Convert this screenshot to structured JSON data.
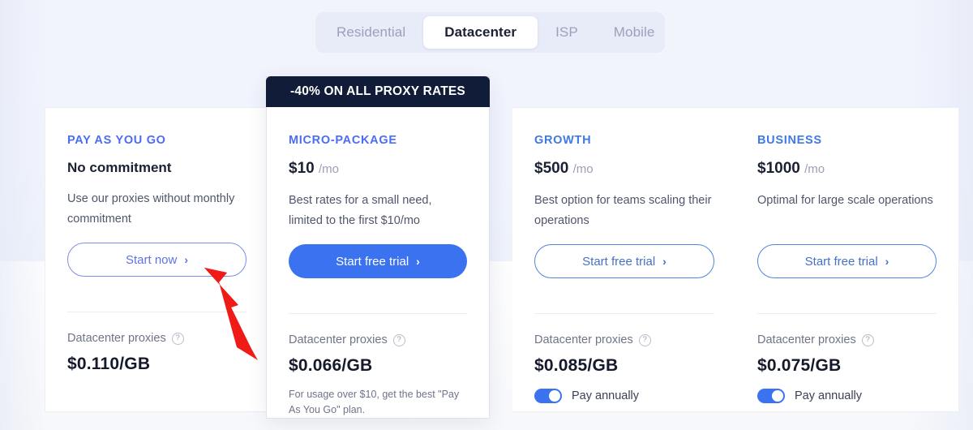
{
  "tabs": {
    "items": [
      {
        "label": "Residential",
        "active": false
      },
      {
        "label": "Datacenter",
        "active": true
      },
      {
        "label": "ISP",
        "active": false
      },
      {
        "label": "Mobile",
        "active": false
      }
    ]
  },
  "featured_banner": {
    "text": "-40% ON ALL PROXY RATES"
  },
  "colors": {
    "accent_blue": "#3b72ef",
    "accent_violet": "#5f73e8",
    "banner_navy": "#101c38",
    "page_bg": "#f1f4fd",
    "annotation_red": "#ee1b16"
  },
  "plans": [
    {
      "name": "PAY AS YOU GO",
      "headline": "No commitment",
      "price": "",
      "period": "",
      "description": "Use our proxies without monthly commitment",
      "cta": "Start now",
      "cta_chevron": "›",
      "proxy_label": "Datacenter proxies",
      "help_icon": "?",
      "rate": "$0.110/GB",
      "note": "",
      "annual_label": "",
      "annual_enabled": false
    },
    {
      "name": "MICRO-PACKAGE",
      "headline": "",
      "price": "$10",
      "period": "/mo",
      "description": "Best rates for a small need, limited to the first $10/mo",
      "cta": "Start free trial",
      "cta_chevron": "›",
      "proxy_label": "Datacenter proxies",
      "help_icon": "?",
      "rate": "$0.066/GB",
      "note": "For usage over $10, get the best \"Pay As You Go\" plan.",
      "annual_label": "",
      "annual_enabled": false
    },
    {
      "name": "GROWTH",
      "headline": "",
      "price": "$500",
      "period": "/mo",
      "description": "Best option for teams scaling their operations",
      "cta": "Start free trial",
      "cta_chevron": "›",
      "proxy_label": "Datacenter proxies",
      "help_icon": "?",
      "rate": "$0.085/GB",
      "note": "",
      "annual_label": "Pay annually",
      "annual_enabled": true
    },
    {
      "name": "BUSINESS",
      "headline": "",
      "price": "$1000",
      "period": "/mo",
      "description": "Optimal for large scale operations",
      "cta": "Start free trial",
      "cta_chevron": "›",
      "proxy_label": "Datacenter proxies",
      "help_icon": "?",
      "rate": "$0.075/GB",
      "note": "",
      "annual_label": "Pay annually",
      "annual_enabled": true
    }
  ],
  "annotation": {
    "type": "arrow",
    "points_to": "Start now"
  }
}
